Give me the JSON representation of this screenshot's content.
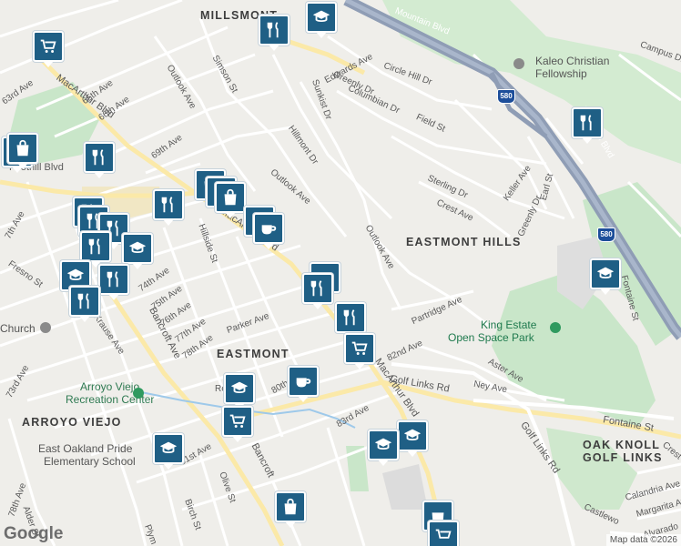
{
  "map": {
    "area_labels": {
      "millsmont": "MILLSMONT",
      "eastmont_hills": "EASTMONT HILLS",
      "eastmont": "EASTMONT",
      "arroyo_viejo": "ARROYO VIEJO",
      "oak_knoll": "OAK KNOLL",
      "golf_links": "GOLF LINKS"
    },
    "poi_labels": {
      "kaleo_1": "Kaleo Christian",
      "kaleo_2": "Fellowship",
      "recreation_1": "Arroyo Viejo",
      "recreation_2": "Recreation Center",
      "school_1": "East Oakland Pride",
      "school_2": "Elementary School",
      "church": "Church",
      "park_1": "King Estate",
      "park_2": "Open Space Park"
    },
    "streets": {
      "edwards_ave": "Edwards Ave",
      "mountain_blvd_top": "Mountain Blvd",
      "campus_dr": "Campus Dr",
      "circle_hill_dr": "Circle Hill Dr",
      "greenly_dr_top": "Greenly Dr",
      "columbian_dr": "Columbian Dr",
      "sunkist_dr": "Sunkist Dr",
      "simson_st": "Simson St",
      "outlook_ave_top": "Outlook Ave",
      "hillmont_dr": "Hillmont Dr",
      "field_st": "Field St",
      "keller_ave": "Keller Ave",
      "sterling_dr": "Sterling Dr",
      "crest_ave": "Crest Ave",
      "greenly_dr": "Greenly Dr",
      "earl_st": "Earl St",
      "mountain_blvd_right": "Mountain Blvd",
      "fontaine_st_right": "Fontaine St",
      "outlook_ave_mid": "Outlook Ave",
      "outlook_ave_low": "Outlook Ave",
      "partridge_ave": "Partridge Ave",
      "ave_82nd": "82nd Ave",
      "aster_ave": "Aster Ave",
      "ney_ave": "Ney Ave",
      "golf_links_rd": "Golf Links Rd",
      "golf_links_rd_2": "Golf Links Rd",
      "fontaine_st": "Fontaine St",
      "macarthur_blvd_top": "MacArthur Blvd",
      "macarthur_blvd_mid": "MacArthur Blvd",
      "macarthur_blvd_low": "MacArthur Blvd",
      "ave_65th": "65th Ave",
      "ave_66th": "66th Ave",
      "ave_63rd": "63rd Ave",
      "ave_69th": "69th Ave",
      "foothill_blvd": "Foothill Blvd",
      "hillside_st": "Hillside St",
      "ave_74th": "74th Ave",
      "ave_75th": "75th Ave",
      "ave_76th": "76th Ave",
      "ave_77th": "77th Ave",
      "ave_78th": "78th Ave",
      "parker_ave": "Parker Ave",
      "bancroft_ave": "Bancroft Ave",
      "bancroft_ave_2": "Bancroft",
      "fresno_st": "Fresno St",
      "krause_ave": "Krause Ave",
      "ave_73rd": "73rd Ave",
      "ave_80th": "80th",
      "ave_83rd": "83rd Ave",
      "ave_81st": "81st Ave",
      "olive_st": "Olive St",
      "birch_st": "Birch St",
      "ave_78th_low": "78th Ave",
      "alder_st": "Alder St",
      "plymouth": "Plym",
      "calandria_ave": "Calandria Ave",
      "margarita_ave": "Margarita Ave",
      "alvarado": "Alvarado",
      "castlewood": "Castlewo",
      "crest": "Crest",
      "bancroft_ve": "Ban",
      "re": "Re",
      "ave_7th": "7th Ave"
    },
    "highway_shields": [
      "580",
      "580"
    ],
    "attribution": "Map data ©2026",
    "google_logo": "Google"
  },
  "colors": {
    "marker_fill": "#1f5f85",
    "freeway": "#8f9db5",
    "park_green": "#c9e6c9",
    "school_tan": "#f1e7c4"
  }
}
